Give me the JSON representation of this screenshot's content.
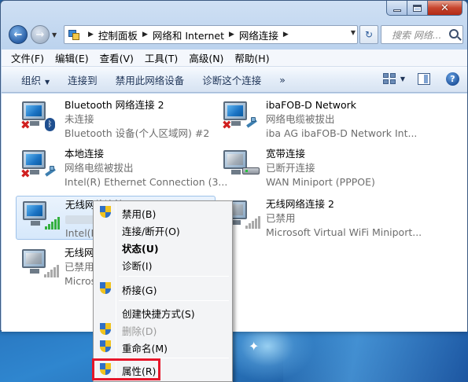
{
  "window": {
    "caption": {
      "minimize": "minimize",
      "maximize": "maximize",
      "close": "close"
    }
  },
  "address": {
    "segments": [
      "控制面板",
      "网络和 Internet",
      "网络连接"
    ],
    "search_placeholder": "搜索 网络..."
  },
  "menu_bar": {
    "items": [
      "文件(F)",
      "编辑(E)",
      "查看(V)",
      "工具(T)",
      "高级(N)",
      "帮助(H)"
    ]
  },
  "toolbar": {
    "organize": "组织",
    "connect_to": "连接到",
    "disable_device": "禁用此网络设备",
    "diagnose": "诊断这个连接",
    "more": "»"
  },
  "connections": [
    {
      "name": "Bluetooth 网络连接 2",
      "status": "未连接",
      "device": "Bluetooth 设备(个人区域网) #2",
      "icon": "bluetooth-network-icon"
    },
    {
      "name": "ibaFOB-D Network",
      "status": "网络电缆被拔出",
      "device": "iba AG ibaFOB-D Network Int...",
      "icon": "wired-network-icon"
    },
    {
      "name": "本地连接",
      "status": "网络电缆被拔出",
      "device": "Intel(R) Ethernet Connection (3...",
      "icon": "wired-network-icon"
    },
    {
      "name": "宽带连接",
      "status": "已断开连接",
      "device": "WAN Miniport (PPPOE)",
      "icon": "broadband-modem-icon"
    },
    {
      "name": "无线网络连接",
      "status": "",
      "device": "Intel(R)",
      "icon": "wireless-signal-icon"
    },
    {
      "name": "无线网络连接 2",
      "status": "已禁用",
      "device": "Microsoft Virtual WiFi Miniport...",
      "icon": "wireless-signal-icon"
    },
    {
      "name": "无线网络",
      "status": "已禁用",
      "device": "Micros",
      "icon": "wireless-signal-icon"
    }
  ],
  "context_menu": {
    "items": [
      {
        "label": "禁用(B)",
        "shield": true
      },
      {
        "label": "连接/断开(O)",
        "shield": false
      },
      {
        "label": "状态(U)",
        "shield": false,
        "bold": true
      },
      {
        "label": "诊断(I)",
        "shield": false
      },
      {
        "label": "桥接(G)",
        "shield": true
      },
      {
        "label": "创建快捷方式(S)",
        "shield": false
      },
      {
        "label": "删除(D)",
        "shield": true,
        "disabled": true
      },
      {
        "label": "重命名(M)",
        "shield": true
      },
      {
        "label": "属性(R)",
        "shield": true
      }
    ]
  },
  "colors": {
    "highlight": "#e6162a",
    "selection": "#d6e8fb",
    "disconnected_x": "#d02020"
  }
}
